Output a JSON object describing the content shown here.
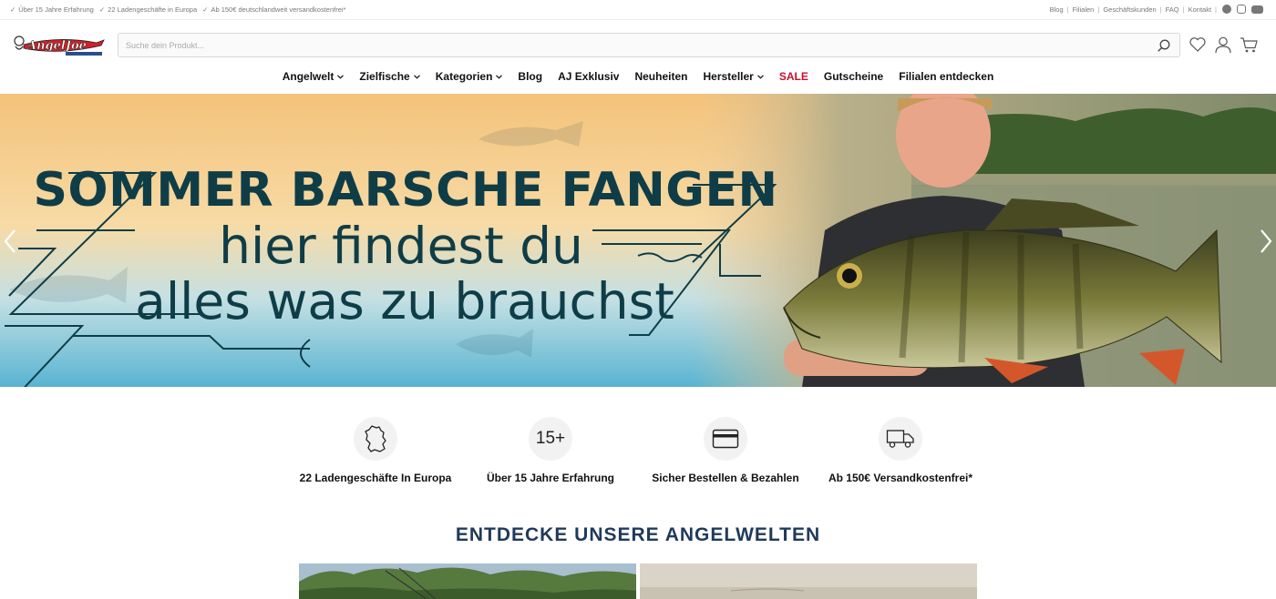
{
  "topbar": {
    "usps": [
      "Über 15 Jahre Erfahrung",
      "22 Ladengeschäfte in Europa",
      "Ab 150€ deutschlandweit versandkostenfrei*"
    ],
    "links": [
      "Blog",
      "Filialen",
      "Geschäftskunden",
      "FAQ",
      "Kontakt"
    ],
    "social_icons": [
      "facebook-icon",
      "instagram-icon",
      "youtube-icon"
    ]
  },
  "header": {
    "logo_text": "AngelJoe",
    "search_placeholder": "Suche dein Produkt...",
    "icons": [
      "search-icon",
      "heart-icon",
      "user-icon",
      "cart-icon"
    ]
  },
  "nav": {
    "items": [
      {
        "label": "Angelwelt",
        "dropdown": true
      },
      {
        "label": "Zielfische",
        "dropdown": true
      },
      {
        "label": "Kategorien",
        "dropdown": true
      },
      {
        "label": "Blog",
        "dropdown": false
      },
      {
        "label": "AJ Exklusiv",
        "dropdown": false
      },
      {
        "label": "Neuheiten",
        "dropdown": false
      },
      {
        "label": "Hersteller",
        "dropdown": true
      },
      {
        "label": "SALE",
        "dropdown": false
      },
      {
        "label": "Gutscheine",
        "dropdown": false
      },
      {
        "label": "Filialen entdecken",
        "dropdown": false
      }
    ]
  },
  "hero": {
    "line1": "SOMMER BARSCHE FANGEN",
    "line2": "hier findest du",
    "line3": "alles was zu brauchst"
  },
  "features": [
    {
      "icon": "germany-map-icon",
      "label": "22 Ladengeschäfte In Europa"
    },
    {
      "icon_text": "15+",
      "label": "Über 15 Jahre Erfahrung"
    },
    {
      "icon": "credit-card-icon",
      "label": "Sicher Bestellen & Bezahlen"
    },
    {
      "icon": "truck-icon",
      "label": "Ab 150€ Versandkostenfrei*"
    }
  ],
  "section": {
    "title": "ENTDECKE UNSERE ANGELWELTEN"
  },
  "colors": {
    "accent_red": "#c8102e",
    "headline": "#0f3d47",
    "section_title": "#1f3a5c"
  }
}
